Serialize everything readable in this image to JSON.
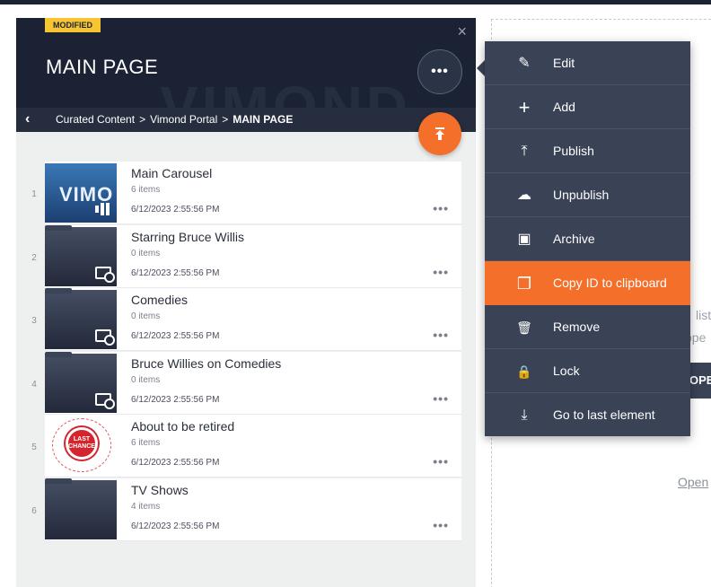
{
  "panel": {
    "badge": "MODIFIED",
    "close": "×",
    "title": "MAIN PAGE",
    "more": "•••",
    "header_bg_word": "VIMOND",
    "breadcrumb": {
      "back": "‹",
      "items": [
        "Curated Content",
        "Vimond Portal"
      ],
      "separator": ">",
      "current": "MAIN PAGE"
    }
  },
  "rows": [
    {
      "index": "1",
      "title": "Main Carousel",
      "count": "6 items",
      "date": "6/12/2023 2:55:56 PM",
      "thumb": "vimond",
      "thumb_text": "VIMO",
      "icon": "carousel-icon"
    },
    {
      "index": "2",
      "title": "Starring Bruce Willis",
      "count": "0 items",
      "date": "6/12/2023 2:55:56 PM",
      "thumb": "folder",
      "icon": "folder-settings-icon"
    },
    {
      "index": "3",
      "title": "Comedies",
      "count": "0 items",
      "date": "6/12/2023 2:55:56 PM",
      "thumb": "folder",
      "icon": "folder-settings-icon"
    },
    {
      "index": "4",
      "title": "Bruce Willies on Comedies",
      "count": "0 items",
      "date": "6/12/2023 2:55:56 PM",
      "thumb": "folder",
      "icon": "folder-settings-icon"
    },
    {
      "index": "5",
      "title": "About to be retired",
      "count": "6 items",
      "date": "6/12/2023 2:55:56 PM",
      "thumb": "lastchance",
      "thumb_text": "LAST CHANCE"
    },
    {
      "index": "6",
      "title": "TV Shows",
      "count": "4 items",
      "date": "6/12/2023 2:55:56 PM",
      "thumb": "folder"
    }
  ],
  "row_more": "•••",
  "menu": {
    "items": [
      {
        "label": "Edit",
        "icon": "pencil-icon",
        "glyph": "✎"
      },
      {
        "label": "Add",
        "icon": "plus-icon",
        "glyph": "+"
      },
      {
        "label": "Publish",
        "icon": "publish-icon",
        "glyph": "⤒"
      },
      {
        "label": "Unpublish",
        "icon": "cloud-off-icon",
        "glyph": "☁"
      },
      {
        "label": "Archive",
        "icon": "archive-icon",
        "glyph": "▣"
      },
      {
        "label": "Copy ID to clipboard",
        "icon": "copy-icon",
        "glyph": "❐",
        "active": true
      },
      {
        "label": "Remove",
        "icon": "trash-icon",
        "glyph": "🗑"
      },
      {
        "label": "Lock",
        "icon": "lock-icon",
        "glyph": "🔒"
      },
      {
        "label": "Go to last element",
        "icon": "go-to-bottom-icon",
        "glyph": "⤓"
      }
    ]
  },
  "dropzone": {
    "text1": "list",
    "text2": "ope",
    "button": "OPE",
    "link": "Open"
  },
  "colors": {
    "header": "#1b2233",
    "accent": "#f36f2a",
    "badge": "#f6c531",
    "menu": "#3a4256"
  }
}
